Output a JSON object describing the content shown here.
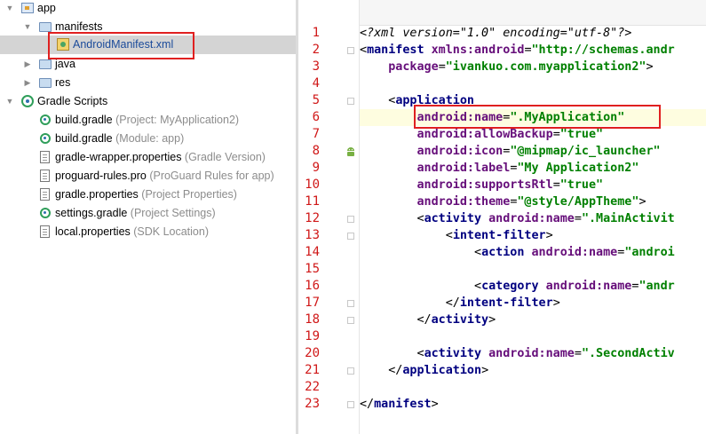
{
  "project_tree": {
    "rows": [
      {
        "label": "app",
        "hint": "",
        "icon": "app-module-icon",
        "expanded": true
      },
      {
        "label": "manifests",
        "hint": "",
        "icon": "folder-icon",
        "expanded": true
      },
      {
        "label": "AndroidManifest.xml",
        "hint": "",
        "icon": "manifest-file-icon",
        "selected": true
      },
      {
        "label": "java",
        "hint": "",
        "icon": "folder-icon",
        "expanded": false
      },
      {
        "label": "res",
        "hint": "",
        "icon": "folder-icon",
        "expanded": false
      },
      {
        "label": "Gradle Scripts",
        "hint": "",
        "icon": "gradle-scripts-icon",
        "expanded": true
      },
      {
        "label": "build.gradle",
        "hint": " (Project: MyApplication2)",
        "icon": "gradle-icon"
      },
      {
        "label": "build.gradle",
        "hint": " (Module: app)",
        "icon": "gradle-icon"
      },
      {
        "label": "gradle-wrapper.properties",
        "hint": " (Gradle Version)",
        "icon": "properties-file-icon"
      },
      {
        "label": "proguard-rules.pro",
        "hint": " (ProGuard Rules for app)",
        "icon": "proguard-file-icon"
      },
      {
        "label": "gradle.properties",
        "hint": " (Project Properties)",
        "icon": "properties-file-icon"
      },
      {
        "label": "settings.gradle",
        "hint": " (Project Settings)",
        "icon": "gradle-icon"
      },
      {
        "label": "local.properties",
        "hint": " (SDK Location)",
        "icon": "properties-file-icon"
      }
    ]
  },
  "editor": {
    "lines": [
      {
        "num": "1",
        "parts": [
          [
            "pi",
            "<?xml version=\"1.0\" encoding=\"utf-8\"?>"
          ]
        ]
      },
      {
        "num": "2",
        "parts": [
          [
            "punct",
            "<"
          ],
          [
            "tag",
            "manifest "
          ],
          [
            "attr",
            "xmlns:android"
          ],
          [
            "punct",
            "="
          ],
          [
            "val",
            "\"http://schemas.andr"
          ]
        ]
      },
      {
        "num": "3",
        "parts": [
          [
            "punct",
            "    "
          ],
          [
            "attr",
            "package"
          ],
          [
            "punct",
            "="
          ],
          [
            "val",
            "\"ivankuo.com.myapplication2\""
          ],
          [
            "punct",
            ">"
          ]
        ]
      },
      {
        "num": "4",
        "parts": []
      },
      {
        "num": "5",
        "parts": [
          [
            "punct",
            "    <"
          ],
          [
            "tag",
            "application"
          ]
        ]
      },
      {
        "num": "6",
        "parts": [
          [
            "punct",
            "        "
          ],
          [
            "attr",
            "android:name"
          ],
          [
            "punct",
            "="
          ],
          [
            "val",
            "\".MyApplication\""
          ]
        ]
      },
      {
        "num": "7",
        "parts": [
          [
            "punct",
            "        "
          ],
          [
            "attr",
            "android:allowBackup"
          ],
          [
            "punct",
            "="
          ],
          [
            "val",
            "\"true\""
          ]
        ]
      },
      {
        "num": "8",
        "parts": [
          [
            "punct",
            "        "
          ],
          [
            "attr",
            "android:icon"
          ],
          [
            "punct",
            "="
          ],
          [
            "val",
            "\"@mipmap/ic_launcher\""
          ]
        ]
      },
      {
        "num": "9",
        "parts": [
          [
            "punct",
            "        "
          ],
          [
            "attr",
            "android:label"
          ],
          [
            "punct",
            "="
          ],
          [
            "val",
            "\"My Application2\""
          ]
        ]
      },
      {
        "num": "10",
        "parts": [
          [
            "punct",
            "        "
          ],
          [
            "attr",
            "android:supportsRtl"
          ],
          [
            "punct",
            "="
          ],
          [
            "val",
            "\"true\""
          ]
        ]
      },
      {
        "num": "11",
        "parts": [
          [
            "punct",
            "        "
          ],
          [
            "attr",
            "android:theme"
          ],
          [
            "punct",
            "="
          ],
          [
            "val",
            "\"@style/AppTheme\""
          ],
          [
            "punct",
            ">"
          ]
        ]
      },
      {
        "num": "12",
        "parts": [
          [
            "punct",
            "        <"
          ],
          [
            "tag",
            "activity "
          ],
          [
            "attr",
            "android:name"
          ],
          [
            "punct",
            "="
          ],
          [
            "val",
            "\".MainActivit"
          ]
        ]
      },
      {
        "num": "13",
        "parts": [
          [
            "punct",
            "            <"
          ],
          [
            "tag",
            "intent-filter"
          ],
          [
            "punct",
            ">"
          ]
        ]
      },
      {
        "num": "14",
        "parts": [
          [
            "punct",
            "                <"
          ],
          [
            "tag",
            "action "
          ],
          [
            "attr",
            "android:name"
          ],
          [
            "punct",
            "="
          ],
          [
            "val",
            "\"androi"
          ]
        ]
      },
      {
        "num": "15",
        "parts": []
      },
      {
        "num": "16",
        "parts": [
          [
            "punct",
            "                <"
          ],
          [
            "tag",
            "category "
          ],
          [
            "attr",
            "android:name"
          ],
          [
            "punct",
            "="
          ],
          [
            "val",
            "\"andr"
          ]
        ]
      },
      {
        "num": "17",
        "parts": [
          [
            "punct",
            "            </"
          ],
          [
            "tag",
            "intent-filter"
          ],
          [
            "punct",
            ">"
          ]
        ]
      },
      {
        "num": "18",
        "parts": [
          [
            "punct",
            "        </"
          ],
          [
            "tag",
            "activity"
          ],
          [
            "punct",
            ">"
          ]
        ]
      },
      {
        "num": "19",
        "parts": []
      },
      {
        "num": "20",
        "parts": [
          [
            "punct",
            "        <"
          ],
          [
            "tag",
            "activity "
          ],
          [
            "attr",
            "android:name"
          ],
          [
            "punct",
            "="
          ],
          [
            "val",
            "\".SecondActiv"
          ]
        ]
      },
      {
        "num": "21",
        "parts": [
          [
            "punct",
            "    </"
          ],
          [
            "tag",
            "application"
          ],
          [
            "punct",
            ">"
          ]
        ]
      },
      {
        "num": "22",
        "parts": []
      },
      {
        "num": "23",
        "parts": [
          [
            "punct",
            "</"
          ],
          [
            "tag",
            "manifest"
          ],
          [
            "punct",
            ">"
          ]
        ]
      }
    ]
  },
  "colors": {
    "selection_bg": "#d4d4d4",
    "highlight_box": "#e02020",
    "line_number": "#d01818",
    "xml_tag": "#000080",
    "xml_attr": "#660e7a",
    "xml_value": "#008000"
  }
}
